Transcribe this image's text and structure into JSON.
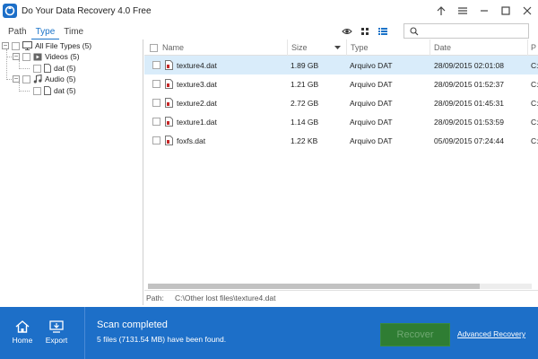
{
  "window": {
    "title": "Do Your Data Recovery 4.0 Free"
  },
  "tabs": [
    {
      "label": "Path"
    },
    {
      "label": "Type",
      "active": true
    },
    {
      "label": "Time"
    }
  ],
  "tree": {
    "root": "All File Types (5)",
    "videos": "Videos (5)",
    "videos_dat": "dat (5)",
    "audio": "Audio (5)",
    "audio_dat": "dat (5)"
  },
  "table": {
    "headers": {
      "name": "Name",
      "size": "Size",
      "type": "Type",
      "date": "Date",
      "path": "P"
    },
    "rows": [
      {
        "name": "texture4.dat",
        "size": "1.89 GB",
        "type": "Arquivo DAT",
        "date": "28/09/2015 02:01:08",
        "path": "C:",
        "selected": true
      },
      {
        "name": "texture3.dat",
        "size": "1.21 GB",
        "type": "Arquivo DAT",
        "date": "28/09/2015 01:52:37",
        "path": "C:"
      },
      {
        "name": "texture2.dat",
        "size": "2.72 GB",
        "type": "Arquivo DAT",
        "date": "28/09/2015 01:45:31",
        "path": "C:"
      },
      {
        "name": "texture1.dat",
        "size": "1.14 GB",
        "type": "Arquivo DAT",
        "date": "28/09/2015 01:53:59",
        "path": "C:"
      },
      {
        "name": "foxfs.dat",
        "size": "1.22 KB",
        "type": "Arquivo DAT",
        "date": "05/09/2015 07:24:44",
        "path": "C:"
      }
    ]
  },
  "pathbar": {
    "label": "Path:",
    "value": "C:\\Other lost files\\texture4.dat"
  },
  "bottom": {
    "home_label": "Home",
    "export_label": "Export",
    "status": "Scan completed",
    "summary": "5 files (7131.54 MB) have been found.",
    "recover_label": "Recover",
    "advanced_label": "Advanced Recovery"
  },
  "colors": {
    "accent": "#1d6fc8",
    "selection": "#d9ecfa",
    "recover_button": "#2f7d33"
  },
  "icons": [
    "app-logo-icon",
    "up-arrow-icon",
    "menu-icon",
    "minimize-icon",
    "maximize-icon",
    "close-icon",
    "eye-icon",
    "grid-view-icon",
    "list-view-icon",
    "search-icon",
    "monitor-icon",
    "video-icon",
    "music-icon",
    "file-icon",
    "home-icon",
    "export-icon"
  ]
}
